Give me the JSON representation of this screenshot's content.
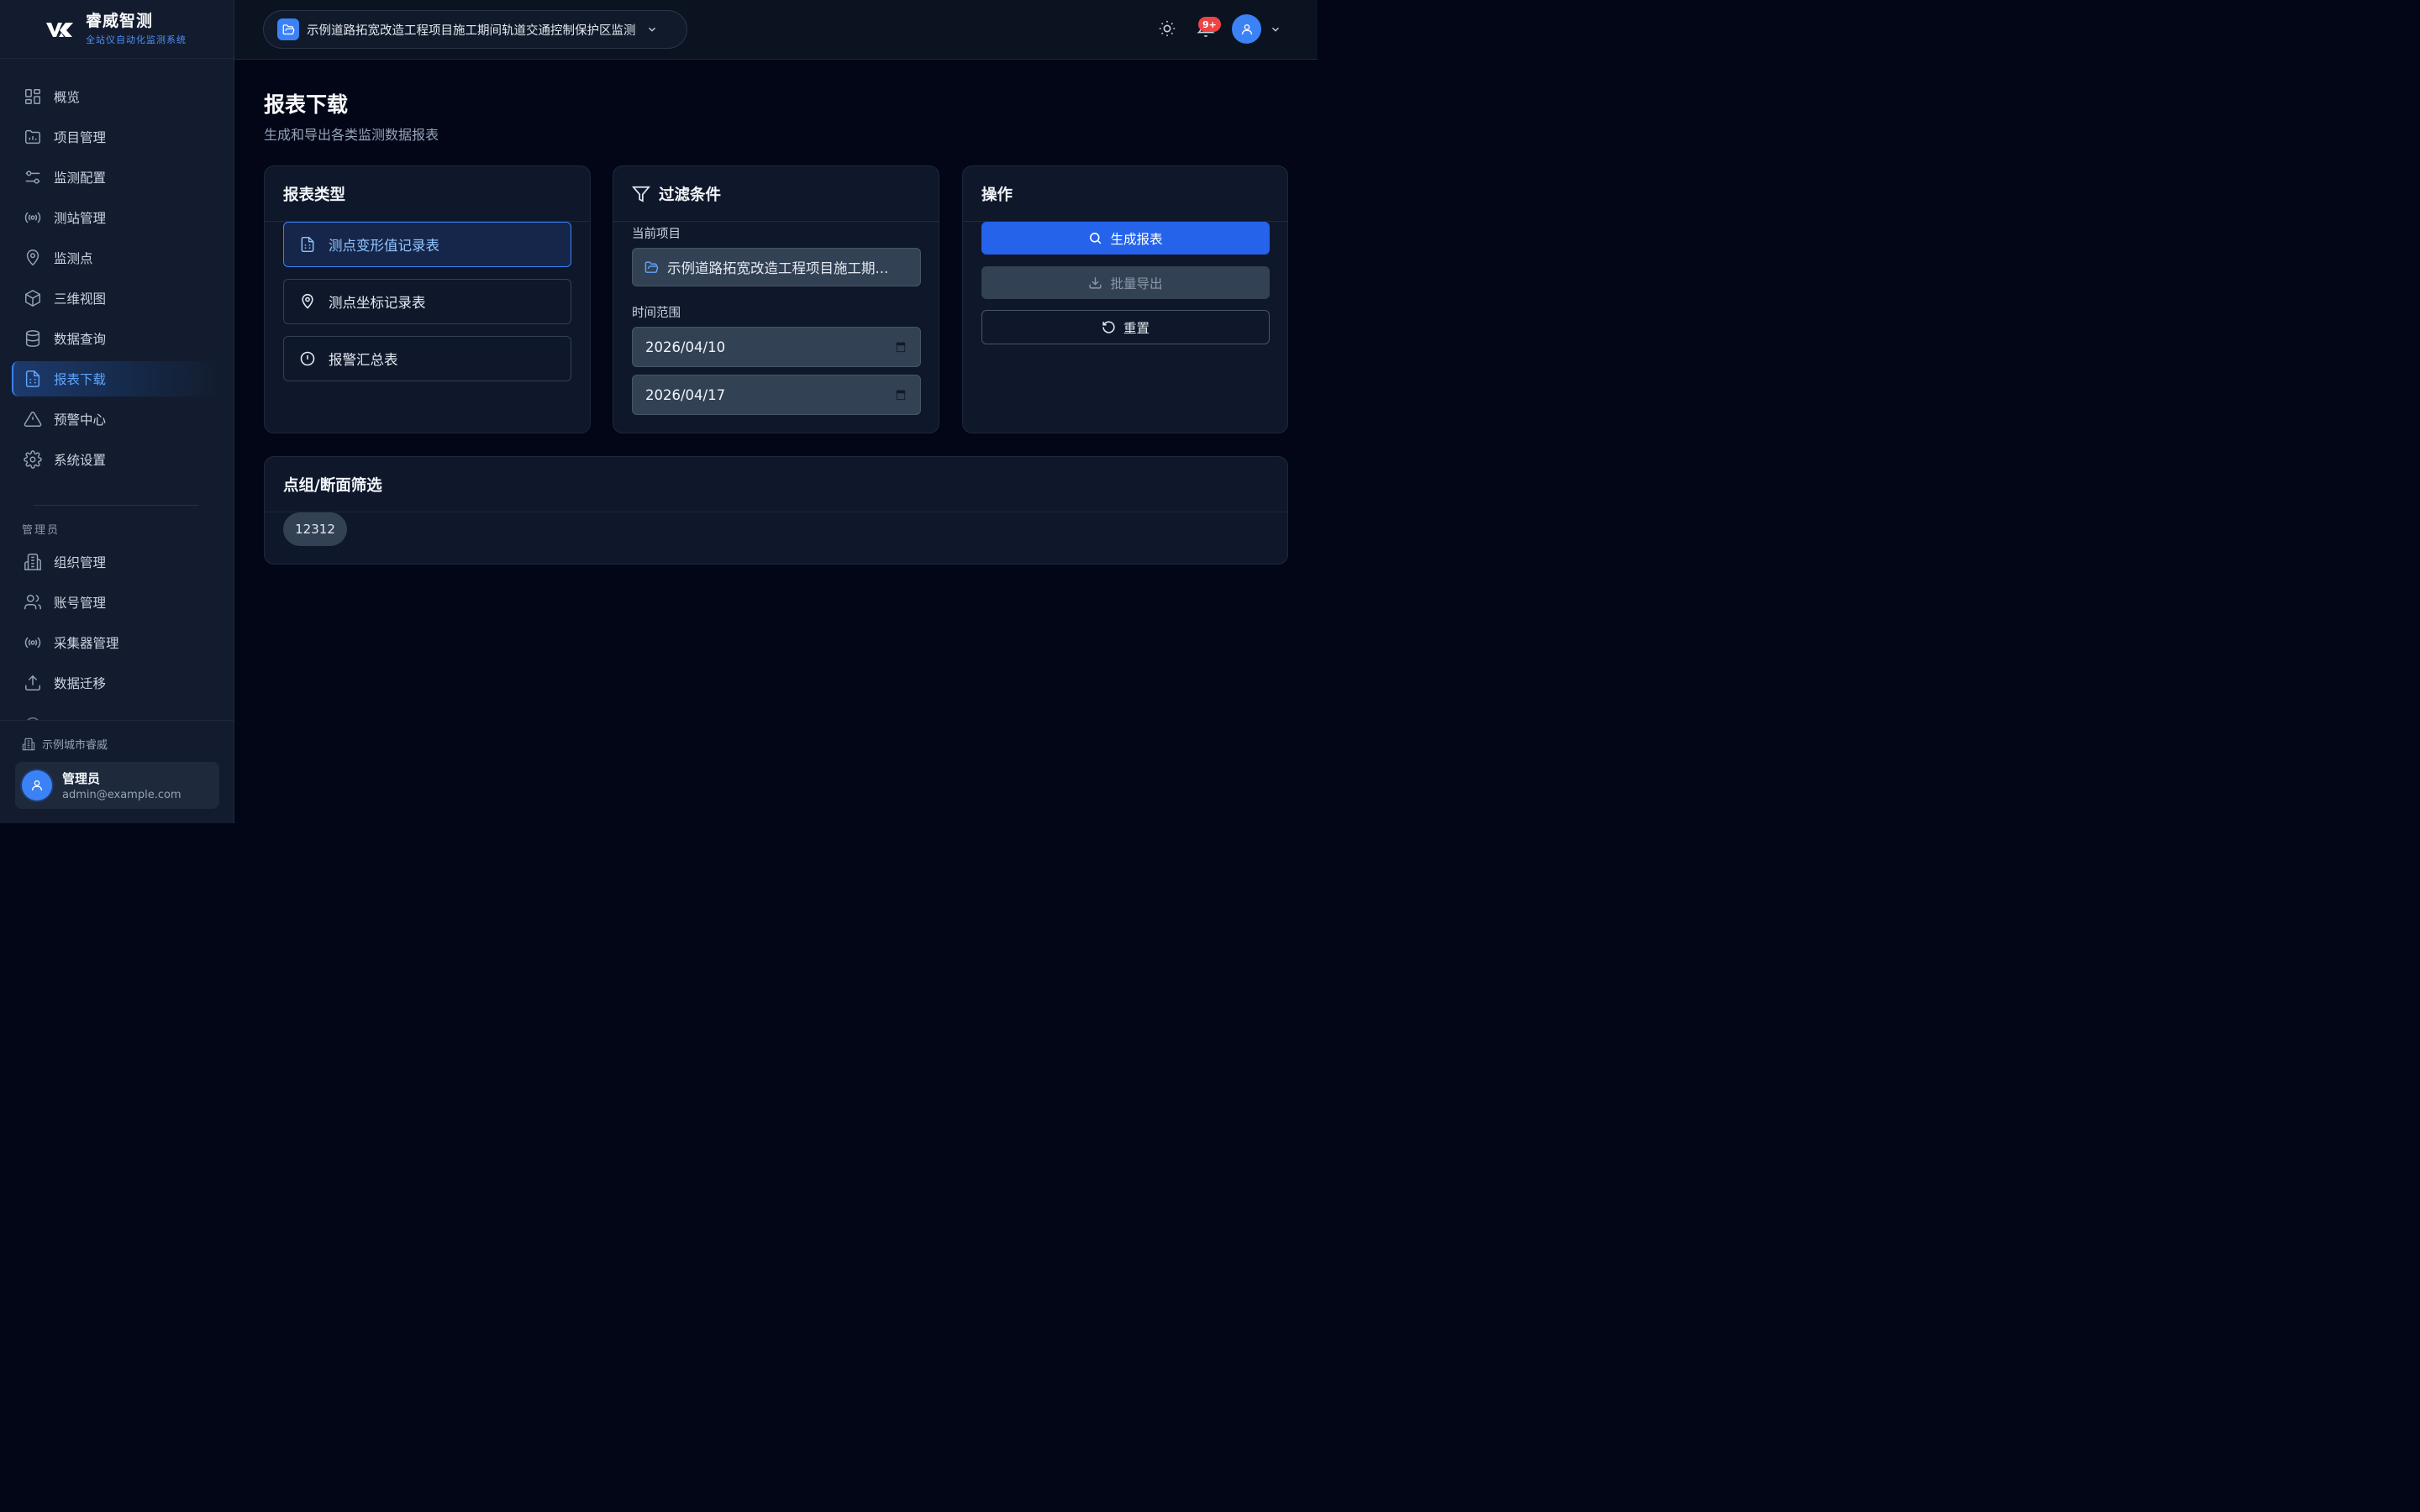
{
  "brand": {
    "name": "睿威智测",
    "subtitle": "全站仪自动化监测系统"
  },
  "sidebar": {
    "items": [
      {
        "label": "概览",
        "icon": "dashboard-grid-icon"
      },
      {
        "label": "项目管理",
        "icon": "folder-chart-icon"
      },
      {
        "label": "监测配置",
        "icon": "sliders-icon"
      },
      {
        "label": "测站管理",
        "icon": "radio-tower-icon"
      },
      {
        "label": "监测点",
        "icon": "map-pin-icon"
      },
      {
        "label": "三维视图",
        "icon": "cube-icon"
      },
      {
        "label": "数据查询",
        "icon": "database-icon"
      },
      {
        "label": "报表下载",
        "icon": "file-spreadsheet-icon",
        "active": true
      },
      {
        "label": "预警中心",
        "icon": "warning-triangle-icon"
      },
      {
        "label": "系统设置",
        "icon": "gear-icon"
      }
    ],
    "admin_section_label": "管理员",
    "admin_items": [
      {
        "label": "组织管理",
        "icon": "building-icon"
      },
      {
        "label": "账号管理",
        "icon": "users-icon"
      },
      {
        "label": "采集器管理",
        "icon": "radio-tower-icon"
      },
      {
        "label": "数据迁移",
        "icon": "upload-icon"
      }
    ],
    "organization": "示例城市睿威",
    "user": {
      "name": "管理员",
      "email": "admin@example.com"
    }
  },
  "topbar": {
    "project": "示例道路拓宽改造工程项目施工期间轨道交通控制保护区监测",
    "notification_badge": "9+"
  },
  "page": {
    "title": "报表下载",
    "subtitle": "生成和导出各类监测数据报表"
  },
  "report_types": {
    "title": "报表类型",
    "options": [
      {
        "label": "测点变形值记录表",
        "icon": "file-spreadsheet-icon",
        "selected": true
      },
      {
        "label": "测点坐标记录表",
        "icon": "map-pin-icon",
        "selected": false
      },
      {
        "label": "报警汇总表",
        "icon": "alert-circle-icon",
        "selected": false
      }
    ]
  },
  "filters": {
    "title": "过滤条件",
    "current_project_label": "当前项目",
    "current_project_value": "示例道路拓宽改造工程项目施工期...",
    "time_range_label": "时间范围",
    "start_date": "2026/04/10",
    "end_date": "2026/04/17"
  },
  "actions": {
    "title": "操作",
    "generate_label": "生成报表",
    "export_label": "批量导出",
    "reset_label": "重置"
  },
  "group_filter": {
    "title": "点组/断面筛选",
    "chips": [
      "12312"
    ]
  },
  "colors": {
    "accent": "#3b82f6",
    "background": "#020617",
    "sidebar": "#131c2e",
    "card": "#0f172a",
    "badge": "#ef4444"
  }
}
